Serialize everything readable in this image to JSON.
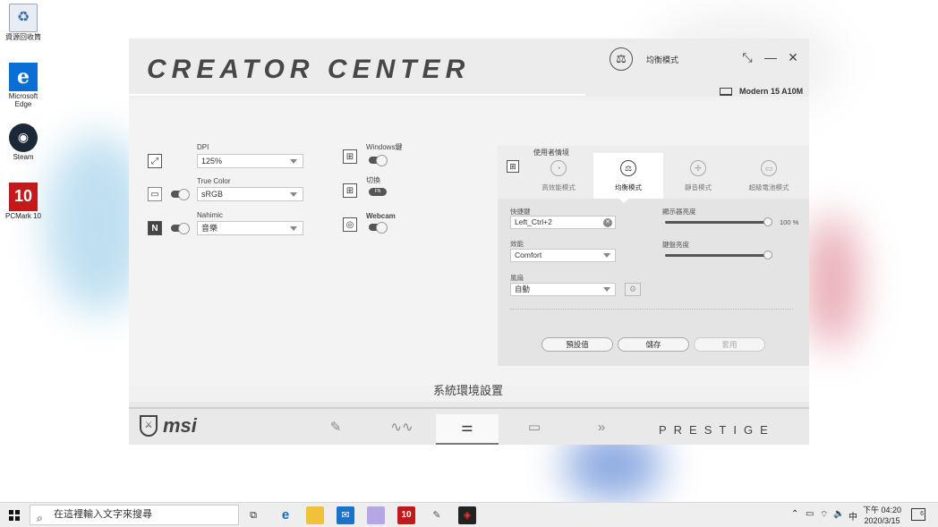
{
  "desktop": {
    "icons": [
      {
        "label": "資源回收筒",
        "icon": "recycle-bin-icon"
      },
      {
        "label": "Microsoft Edge",
        "icon": "edge-icon"
      },
      {
        "label": "Steam",
        "icon": "steam-icon"
      },
      {
        "label": "PCMark 10",
        "icon": "pcmark-icon"
      }
    ]
  },
  "window": {
    "title": "CREATOR CENTER",
    "mode_label": "均衡模式",
    "model": "Modern 15 A10M"
  },
  "left": {
    "dpi_label": "DPI",
    "dpi_value": "125%",
    "true_color_label": "True Color",
    "true_color_value": "sRGB",
    "nahimic_label": "Nahimic",
    "nahimic_value": "音樂",
    "windows_key_label": "Windows鍵",
    "switch_label": "切換",
    "switch_pill": "FN",
    "webcam_label": "Webcam"
  },
  "panel": {
    "title": "使用者情境",
    "modes": [
      {
        "label": "高效能模式",
        "icon": "speedometer-icon"
      },
      {
        "label": "均衡模式",
        "icon": "balance-scale-icon"
      },
      {
        "label": "靜音模式",
        "icon": "silent-fan-icon"
      },
      {
        "label": "超級電池模式",
        "icon": "battery-icon"
      }
    ],
    "hotkey_label": "快捷鍵",
    "hotkey_value": "Left_Ctrl+2",
    "performance_label": "效能",
    "performance_value": "Comfort",
    "fan_label": "風扇",
    "fan_value": "自動",
    "brightness_label": "顯示器亮度",
    "brightness_value": "100 %",
    "brightness_level": 1.0,
    "keyboard_label": "鍵盤亮度",
    "keyboard_level": 1.0,
    "default_button": "預設值",
    "save_button": "儲存",
    "apply_button": "套用"
  },
  "footer": {
    "section_title": "系統環境設置",
    "brand": "msi",
    "series": "PRESTIGE"
  },
  "taskbar": {
    "search_placeholder": "在這裡輸入文字來搜尋",
    "ime": "中",
    "time": "下午 04:20",
    "date": "2020/3/15",
    "notification_count": "6"
  },
  "colors": {
    "window_bg": "#f1f1f1",
    "panel_bg": "#e4e4e4",
    "accent_dark": "#555555",
    "edge_blue": "#0a6fd4",
    "pcmark_red": "#c21a1a"
  }
}
